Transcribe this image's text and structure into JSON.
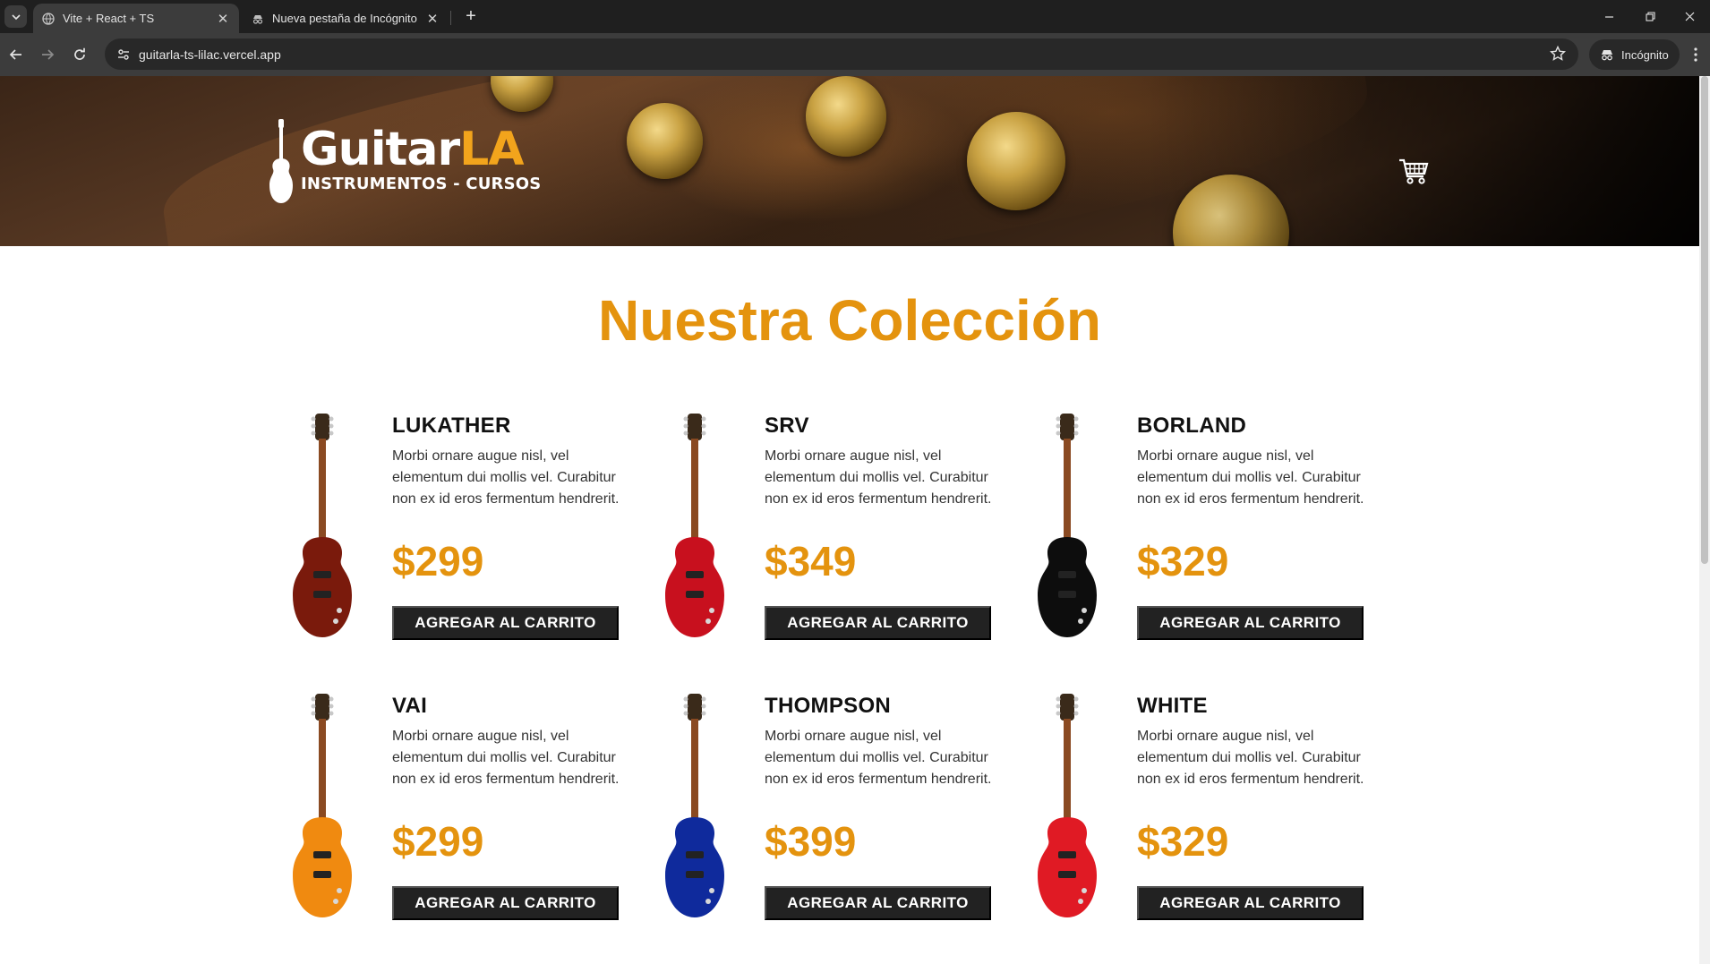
{
  "browser": {
    "tabs": [
      {
        "title": "Vite + React + TS",
        "active": true
      },
      {
        "title": "Nueva pestaña de Incógnito",
        "active": false
      }
    ],
    "url": "guitarla-ts-lilac.vercel.app",
    "profile_label": "Incógnito"
  },
  "header": {
    "logo_word": "Guitar",
    "logo_accent": "LA",
    "logo_tagline": "INSTRUMENTOS - CURSOS"
  },
  "main": {
    "heading": "Nuestra Colección"
  },
  "colors": {
    "accent": "#e4930e",
    "button_bg": "#222222"
  },
  "products": [
    {
      "name": "LUKATHER",
      "description": "Morbi ornare augue nisl, vel elementum dui mollis vel. Curabitur non ex id eros fermentum hendrerit.",
      "price": "$299",
      "button": "AGREGAR AL CARRITO",
      "guitar_color": "#7a1a0c"
    },
    {
      "name": "SRV",
      "description": "Morbi ornare augue nisl, vel elementum dui mollis vel. Curabitur non ex id eros fermentum hendrerit.",
      "price": "$349",
      "button": "AGREGAR AL CARRITO",
      "guitar_color": "#c8101e"
    },
    {
      "name": "BORLAND",
      "description": "Morbi ornare augue nisl, vel elementum dui mollis vel. Curabitur non ex id eros fermentum hendrerit.",
      "price": "$329",
      "button": "AGREGAR AL CARRITO",
      "guitar_color": "#0d0d0d"
    },
    {
      "name": "VAI",
      "description": "Morbi ornare augue nisl, vel elementum dui mollis vel. Curabitur non ex id eros fermentum hendrerit.",
      "price": "$299",
      "button": "AGREGAR AL CARRITO",
      "guitar_color": "#f08a10"
    },
    {
      "name": "THOMPSON",
      "description": "Morbi ornare augue nisl, vel elementum dui mollis vel. Curabitur non ex id eros fermentum hendrerit.",
      "price": "$399",
      "button": "AGREGAR AL CARRITO",
      "guitar_color": "#0f2a9c"
    },
    {
      "name": "WHITE",
      "description": "Morbi ornare augue nisl, vel elementum dui mollis vel. Curabitur non ex id eros fermentum hendrerit.",
      "price": "$329",
      "button": "AGREGAR AL CARRITO",
      "guitar_color": "#e01a24"
    }
  ]
}
